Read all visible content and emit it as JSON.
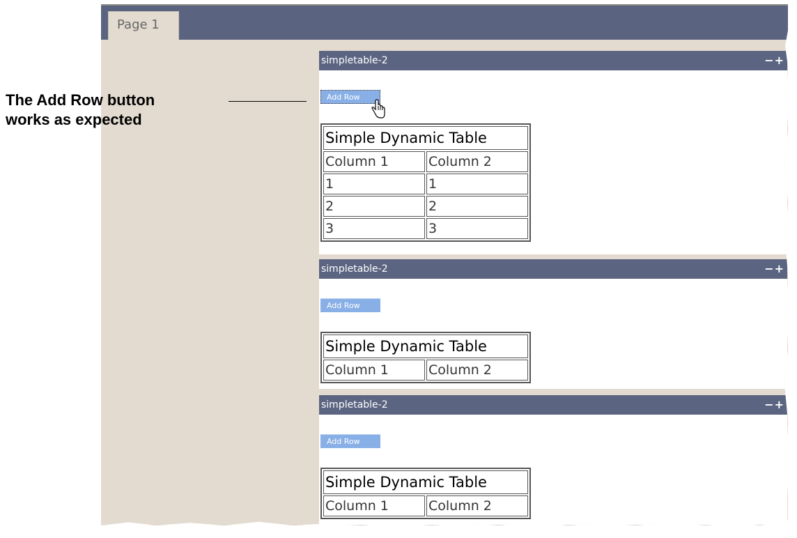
{
  "window": {
    "page_tab": "Page 1"
  },
  "panels": [
    {
      "title": "simpletable-2",
      "controls": "−+",
      "button": "Add Row",
      "table": {
        "title": "Simple Dynamic Table",
        "headers": [
          "Column 1",
          "Column 2"
        ],
        "rows": [
          [
            "1",
            "1"
          ],
          [
            "2",
            "2"
          ],
          [
            "3",
            "3"
          ]
        ]
      }
    },
    {
      "title": "simpletable-2",
      "controls": "−+",
      "button": "Add Row",
      "table": {
        "title": "Simple Dynamic Table",
        "headers": [
          "Column 1",
          "Column 2"
        ],
        "rows": []
      }
    },
    {
      "title": "simpletable-2",
      "controls": "−+",
      "button": "Add Row",
      "table": {
        "title": "Simple Dynamic Table",
        "headers": [
          "Column 1",
          "Column 2"
        ],
        "rows": []
      }
    }
  ],
  "annotation": {
    "line1": "The Add Row button",
    "line2": "works as expected"
  },
  "colors": {
    "header_bg": "#5b6582",
    "button_bg": "#88afe6",
    "page_bg": "#e3dbd0"
  }
}
